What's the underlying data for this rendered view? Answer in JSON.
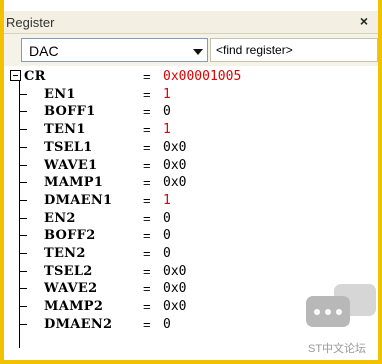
{
  "panel": {
    "title": "Register",
    "close_glyph": "×"
  },
  "toolbar": {
    "peripheral": "DAC",
    "find_placeholder": "<find register>"
  },
  "registers": [
    {
      "name": "CR",
      "value": "0x00001005",
      "changed": true,
      "level": 0
    },
    {
      "name": "EN1",
      "value": "1",
      "changed": true,
      "level": 1
    },
    {
      "name": "BOFF1",
      "value": "0",
      "changed": false,
      "level": 1
    },
    {
      "name": "TEN1",
      "value": "1",
      "changed": true,
      "level": 1
    },
    {
      "name": "TSEL1",
      "value": "0x0",
      "changed": false,
      "level": 1
    },
    {
      "name": "WAVE1",
      "value": "0x0",
      "changed": false,
      "level": 1
    },
    {
      "name": "MAMP1",
      "value": "0x0",
      "changed": false,
      "level": 1
    },
    {
      "name": "DMAEN1",
      "value": "1",
      "changed": true,
      "level": 1
    },
    {
      "name": "EN2",
      "value": "0",
      "changed": false,
      "level": 1
    },
    {
      "name": "BOFF2",
      "value": "0",
      "changed": false,
      "level": 1
    },
    {
      "name": "TEN2",
      "value": "0",
      "changed": false,
      "level": 1
    },
    {
      "name": "TSEL2",
      "value": "0x0",
      "changed": false,
      "level": 1
    },
    {
      "name": "WAVE2",
      "value": "0x0",
      "changed": false,
      "level": 1
    },
    {
      "name": "MAMP2",
      "value": "0x0",
      "changed": false,
      "level": 1
    },
    {
      "name": "DMAEN2",
      "value": "0",
      "changed": false,
      "level": 1
    }
  ],
  "equals": "=",
  "watermark": {
    "text": "ST中文论坛"
  },
  "colors": {
    "changed": "#e00000",
    "frame": "#f2c200"
  }
}
